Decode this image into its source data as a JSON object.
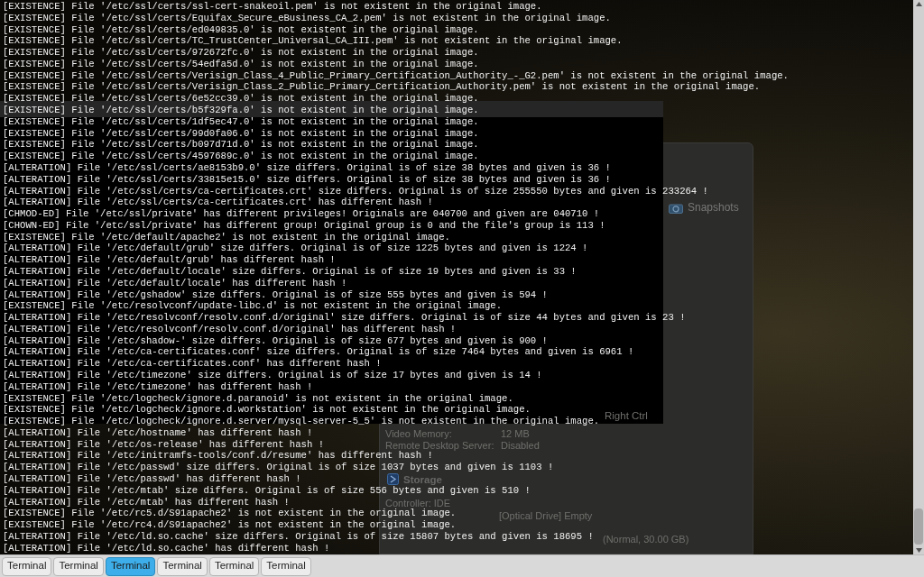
{
  "terminal": {
    "lines": [
      "[EXISTENCE] File '/etc/ssl/certs/ssl-cert-snakeoil.pem' is not existent in the original image.",
      "[EXISTENCE] File '/etc/ssl/certs/Equifax_Secure_eBusiness_CA_2.pem' is not existent in the original image.",
      "[EXISTENCE] File '/etc/ssl/certs/ed049835.0' is not existent in the original image.",
      "[EXISTENCE] File '/etc/ssl/certs/TC_TrustCenter_Universal_CA_III.pem' is not existent in the original image.",
      "[EXISTENCE] File '/etc/ssl/certs/972672fc.0' is not existent in the original image.",
      "[EXISTENCE] File '/etc/ssl/certs/54edfa5d.0' is not existent in the original image.",
      "[EXISTENCE] File '/etc/ssl/certs/Verisign_Class_4_Public_Primary_Certification_Authority_-_G2.pem' is not existent in the original image.",
      "[EXISTENCE] File '/etc/ssl/certs/Verisign_Class_2_Public_Primary_Certification_Authority.pem' is not existent in the original image.",
      "[EXISTENCE] File '/etc/ssl/certs/6e52cc39.0' is not existent in the original image.",
      "[EXISTENCE] File '/etc/ssl/certs/b5f329fa.0' is not existent in the original image.",
      "[EXISTENCE] File '/etc/ssl/certs/1df5ec47.0' is not existent in the original image.",
      "[EXISTENCE] File '/etc/ssl/certs/99d0fa06.0' is not existent in the original image.",
      "[EXISTENCE] File '/etc/ssl/certs/b097d71d.0' is not existent in the original image.",
      "[EXISTENCE] File '/etc/ssl/certs/4597689c.0' is not existent in the original image.",
      "[ALTERATION] File '/etc/ssl/certs/ae8153b9.0' size differs. Original is of size 38 bytes and given is 36 !",
      "[ALTERATION] File '/etc/ssl/certs/33815e15.0' size differs. Original is of size 38 bytes and given is 36 !",
      "[ALTERATION] File '/etc/ssl/certs/ca-certificates.crt' size differs. Original is of size 255550 bytes and given is 233264 !",
      "[ALTERATION] File '/etc/ssl/certs/ca-certificates.crt' has different hash !",
      "[CHMOD-ED] File '/etc/ssl/private' has different privileges! Originals are 040700 and given are 040710 !",
      "[CHOWN-ED] File '/etc/ssl/private' has different group! Original group is 0 and the file's group is 113 !",
      "[EXISTENCE] File '/etc/default/apache2' is not existent in the original image.",
      "[ALTERATION] File '/etc/default/grub' size differs. Original is of size 1225 bytes and given is 1224 !",
      "[ALTERATION] File '/etc/default/grub' has different hash !",
      "[ALTERATION] File '/etc/default/locale' size differs. Original is of size 19 bytes and given is 33 !",
      "[ALTERATION] File '/etc/default/locale' has different hash !",
      "[ALTERATION] File '/etc/gshadow' size differs. Original is of size 555 bytes and given is 594 !",
      "[EXISTENCE] File '/etc/resolvconf/update-libc.d' is not existent in the original image.",
      "[ALTERATION] File '/etc/resolvconf/resolv.conf.d/original' size differs. Original is of size 44 bytes and given is 23 !",
      "[ALTERATION] File '/etc/resolvconf/resolv.conf.d/original' has different hash !",
      "[ALTERATION] File '/etc/shadow-' size differs. Original is of size 677 bytes and given is 900 !",
      "[ALTERATION] File '/etc/ca-certificates.conf' size differs. Original is of size 7464 bytes and given is 6961 !",
      "[ALTERATION] File '/etc/ca-certificates.conf' has different hash !",
      "[ALTERATION] File '/etc/timezone' size differs. Original is of size 17 bytes and given is 14 !",
      "[ALTERATION] File '/etc/timezone' has different hash !",
      "[EXISTENCE] File '/etc/logcheck/ignore.d.paranoid' is not existent in the original image.",
      "[EXISTENCE] File '/etc/logcheck/ignore.d.workstation' is not existent in the original image.",
      "[EXISTENCE] File '/etc/logcheck/ignore.d.server/mysql-server-5_5' is not existent in the original image.",
      "[ALTERATION] File '/etc/hostname' has different hash !",
      "[ALTERATION] File '/etc/os-release' has different hash !",
      "[ALTERATION] File '/etc/initramfs-tools/conf.d/resume' has different hash !",
      "[ALTERATION] File '/etc/passwd' size differs. Original is of size 1037 bytes and given is 1103 !",
      "[ALTERATION] File '/etc/passwd' has different hash !",
      "[ALTERATION] File '/etc/mtab' size differs. Original is of size 556 bytes and given is 510 !",
      "[ALTERATION] File '/etc/mtab' has different hash !",
      "[EXISTENCE] File '/etc/rc5.d/S91apache2' is not existent in the original image.",
      "[EXISTENCE] File '/etc/rc4.d/S91apache2' is not existent in the original image.",
      "[ALTERATION] File '/etc/ld.so.cache' size differs. Original is of size 15807 bytes and given is 18695 !",
      "[ALTERATION] File '/etc/ld.so.cache' has different hash !"
    ]
  },
  "background_window": {
    "tab": "Snapshots",
    "host_key": "Right Ctrl",
    "display": [
      {
        "label": "Video Memory:",
        "value": "12 MB"
      },
      {
        "label": "Remote Desktop Server:",
        "value": "Disabled"
      }
    ],
    "storage": {
      "title": "Storage",
      "controller": "Controller: IDE",
      "device": "[Optical Drive] Empty",
      "disk": "(Normal, 30.00 GB)"
    }
  },
  "taskbar": {
    "buttons": [
      {
        "label": "Terminal",
        "selected": false
      },
      {
        "label": "Terminal",
        "selected": false
      },
      {
        "label": "Terminal",
        "selected": true
      },
      {
        "label": "Terminal",
        "selected": false
      },
      {
        "label": "Terminal",
        "selected": false
      },
      {
        "label": "Terminal",
        "selected": false
      }
    ]
  }
}
